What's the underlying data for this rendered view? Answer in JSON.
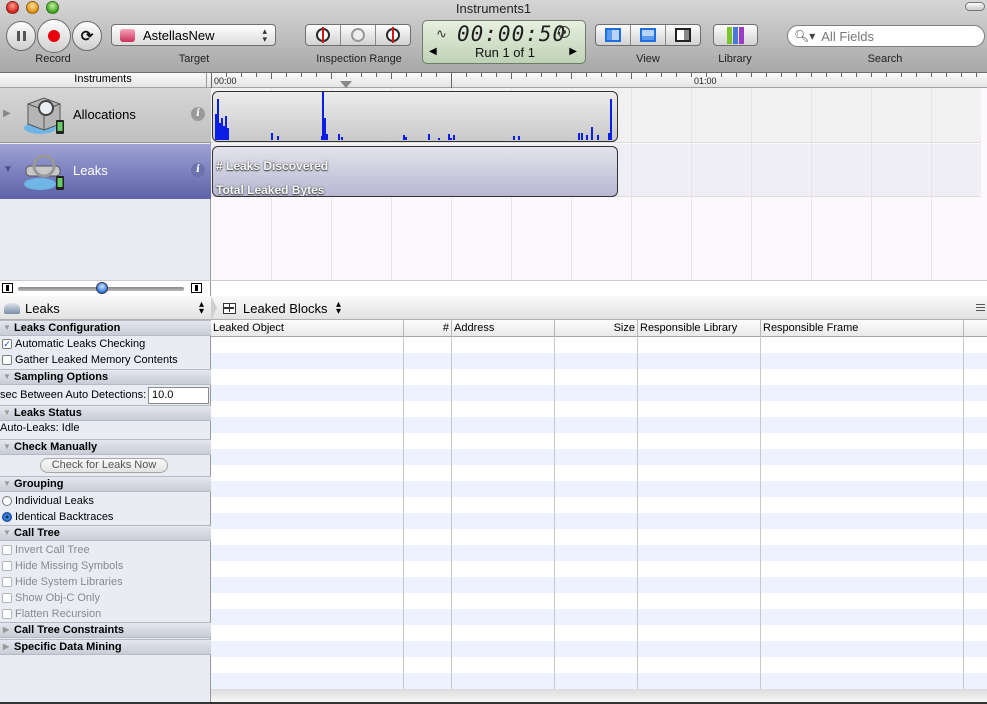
{
  "window": {
    "title": "Instruments1"
  },
  "toolbar": {
    "record_label": "Record",
    "target_label": "Target",
    "target_value": "AstellasNew",
    "inspection_range_label": "Inspection Range",
    "timer": "00:00:50",
    "run_text": "Run 1 of 1",
    "view_label": "View",
    "library_label": "Library",
    "search_label": "Search",
    "search_placeholder": "All Fields",
    "icons": {
      "pause": "pause-icon",
      "record": "record-icon",
      "loop": "loop-icon",
      "library": "books-icon"
    }
  },
  "timeline": {
    "instruments_header": "Instruments",
    "ticks": [
      "00:00",
      "01:00"
    ]
  },
  "instruments": [
    {
      "name": "Allocations",
      "icon": "allocations-icon",
      "expanded": false
    },
    {
      "name": "Leaks",
      "icon": "leaks-icon",
      "expanded": true,
      "selected": true
    }
  ],
  "tracks": {
    "allocations_activity": [
      0.55,
      0.85,
      0.35,
      0.45,
      0.3,
      0.5,
      0.25,
      0.15,
      0.08,
      0.08,
      1.0,
      0.45,
      0.12,
      0.12,
      0.06,
      0.1,
      0.06,
      0.12,
      0.05,
      0.05,
      0.1,
      0.12,
      0.08,
      0.08,
      0.15,
      0.15,
      0.1,
      0.28,
      0.1,
      0.15,
      0.85
    ],
    "leaks_labels": [
      "# Leaks Discovered",
      "Total Leaked Bytes"
    ]
  },
  "zoom_slider": {
    "value": 0.5
  },
  "detail": {
    "instrument_selector": "Leaks",
    "view_selector": "Leaked Blocks"
  },
  "inspector": {
    "sections": {
      "leaks_configuration": "Leaks Configuration",
      "sampling_options": "Sampling Options",
      "leaks_status": "Leaks Status",
      "check_manually": "Check Manually",
      "grouping": "Grouping",
      "call_tree": "Call Tree",
      "call_tree_constraints": "Call Tree Constraints",
      "specific_data_mining": "Specific Data Mining"
    },
    "automatic_leaks_checking": {
      "label": "Automatic Leaks Checking",
      "checked": true
    },
    "gather_leaked_memory": {
      "label": "Gather Leaked Memory Contents",
      "checked": false
    },
    "sec_between_label": "sec Between Auto Detections:",
    "sec_between_value": "10.0",
    "auto_leaks_status": "Auto-Leaks: Idle",
    "check_now_button": "Check for Leaks Now",
    "grouping_options": [
      {
        "label": "Individual Leaks",
        "selected": false
      },
      {
        "label": "Identical Backtraces",
        "selected": true
      }
    ],
    "call_tree_options": [
      {
        "label": "Invert Call Tree",
        "checked": false
      },
      {
        "label": "Hide Missing Symbols",
        "checked": false
      },
      {
        "label": "Hide System Libraries",
        "checked": false
      },
      {
        "label": "Show Obj-C Only",
        "checked": false
      },
      {
        "label": "Flatten Recursion",
        "checked": false
      }
    ]
  },
  "table": {
    "columns": [
      "Leaked Object",
      "#",
      "Address",
      "Size",
      "Responsible Library",
      "Responsible Frame"
    ],
    "rows": []
  },
  "colors": {
    "selected_instrument": "#5d62a8",
    "activity_bar": "#0a1ee6",
    "row_stripe": "#edf3fe"
  }
}
